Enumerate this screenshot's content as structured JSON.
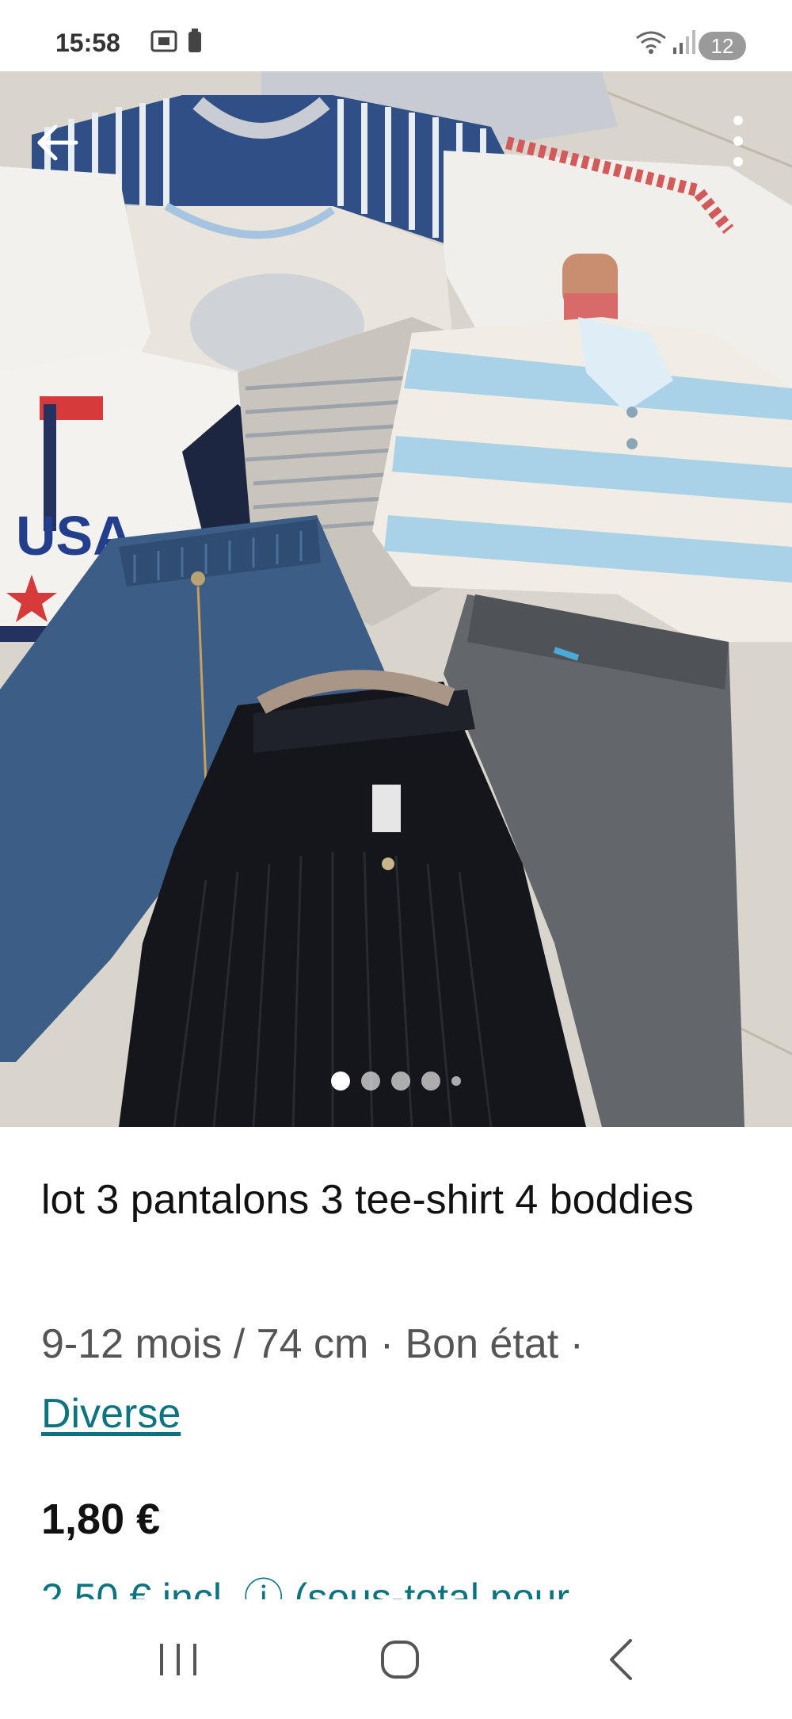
{
  "status_bar": {
    "time": "15:58",
    "notification_count": "12",
    "icons": [
      "screenshot-icon",
      "battery-icon",
      "wifi-icon",
      "signal-icon"
    ]
  },
  "photo": {
    "description_icons": [
      "back-arrow-icon",
      "more-options-icon"
    ],
    "carousel_dot_count": 5,
    "carousel_active_index": 0
  },
  "listing": {
    "title": "lot 3 pantalons 3 tee-shirt 4 boddies",
    "size": "9-12 mois / 74 cm",
    "separator": " · ",
    "condition": "Bon état",
    "brand": "Diverse",
    "price": "1,80 €",
    "subtotal_partial": "2,50 € incl. ⓘ (sous-total pour"
  },
  "nav_bar": {
    "icons": [
      "recent-apps-icon",
      "home-icon",
      "back-icon"
    ]
  },
  "colors": {
    "link": "#0b7480",
    "text": "#111111",
    "muted": "#555555"
  }
}
